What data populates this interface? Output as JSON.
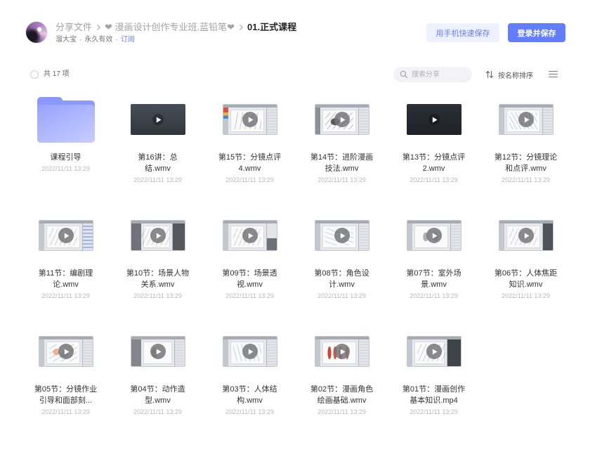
{
  "header": {
    "breadcrumb": [
      {
        "label": "分享文件"
      },
      {
        "label": "❤ 漫画设计创作专业班.蓝铅笔❤"
      },
      {
        "label": "01.正式课程"
      }
    ],
    "owner": "溜大宝",
    "separator": "·",
    "validity": "永久有效",
    "subscribe_label": "订阅"
  },
  "actions": {
    "mobile_save_label": "用手机快速保存",
    "login_save_label": "登录并保存"
  },
  "toolbar": {
    "count_label": "共 17 项",
    "search_placeholder": "搜索分享",
    "sort_label": "按名称排序"
  },
  "colors": {
    "accent": "#637dff",
    "accent_soft": "#eef1ff",
    "folder": "#8a98ff",
    "text_primary": "#333333",
    "date_text": "#b9b9b9"
  },
  "icons": {
    "breadcrumb_separator": "chevron-right-icon",
    "select_all": "circle-checkbox-icon",
    "search": "search-icon",
    "sort": "sort-icon",
    "view_mode": "menu-icon",
    "play": "play-icon",
    "folder": "folder-icon"
  },
  "files": [
    {
      "icon": "folder-icon",
      "lines": [
        "课程引导"
      ],
      "date": "2022/11/11 13:29"
    },
    {
      "icon": "play-icon",
      "lines": [
        "第16讲：总",
        "结.wmv"
      ],
      "date": "2022/11/11 13:29"
    },
    {
      "icon": "play-icon",
      "lines": [
        "第15节：分镜点评",
        "4.wmv"
      ],
      "date": "2022/11/11 13:29"
    },
    {
      "icon": "play-icon",
      "lines": [
        "第14节：进阶漫画",
        "技法.wmv"
      ],
      "date": "2022/11/11 13:29"
    },
    {
      "icon": "play-icon",
      "lines": [
        "第13节：分镜点评",
        "2.wmv"
      ],
      "date": "2022/11/11 13:29"
    },
    {
      "icon": "play-icon",
      "lines": [
        "第12节：分镜理论",
        "和点评.wmv"
      ],
      "date": "2022/11/11 13:29"
    },
    {
      "icon": "play-icon",
      "lines": [
        "第11节：编剧理",
        "论.wmv"
      ],
      "date": "2022/11/11 13:29"
    },
    {
      "icon": "play-icon",
      "lines": [
        "第10节：场景人物",
        "关系.wmv"
      ],
      "date": "2022/11/11 13:29"
    },
    {
      "icon": "play-icon",
      "lines": [
        "第09节：场景透",
        "视.wmv"
      ],
      "date": "2022/11/11 13:29"
    },
    {
      "icon": "play-icon",
      "lines": [
        "第08节：角色设",
        "计.wmv"
      ],
      "date": "2022/11/11 13:29"
    },
    {
      "icon": "play-icon",
      "lines": [
        "第07节：室外场",
        "景.wmv"
      ],
      "date": "2022/11/11 13:29"
    },
    {
      "icon": "play-icon",
      "lines": [
        "第06节：人体焦距",
        "知识.wmv"
      ],
      "date": "2022/11/11 13:29"
    },
    {
      "icon": "play-icon",
      "lines": [
        "第05节：分镜作业",
        "引导和面部刻..."
      ],
      "date": "2022/11/11 13:29"
    },
    {
      "icon": "play-icon",
      "lines": [
        "第04节：动作造",
        "型.wmv"
      ],
      "date": "2022/11/11 13:29"
    },
    {
      "icon": "play-icon",
      "lines": [
        "第03节：人体结",
        "构.wmv"
      ],
      "date": "2022/11/11 13:29"
    },
    {
      "icon": "play-icon",
      "lines": [
        "第02节：漫画角色",
        "绘画基础.wmv"
      ],
      "date": "2022/11/11 13:29"
    },
    {
      "icon": "play-icon",
      "lines": [
        "第01节：漫画创作",
        "基本知识.mp4"
      ],
      "date": "2022/11/11 13:29"
    }
  ]
}
